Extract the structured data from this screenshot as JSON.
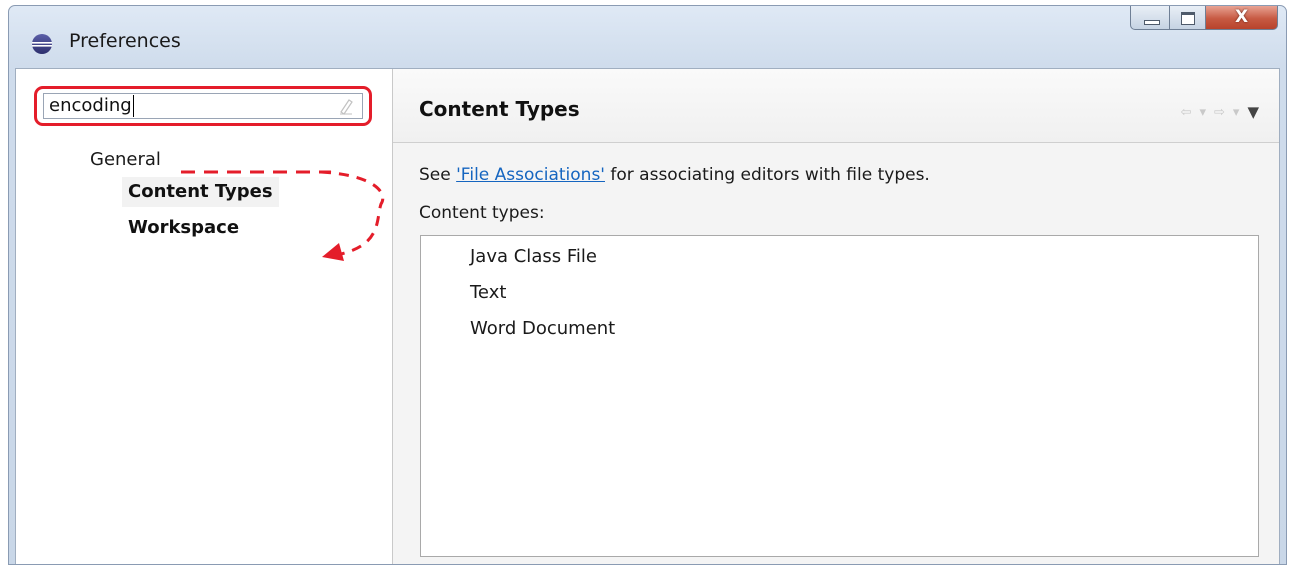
{
  "window": {
    "title": "Preferences",
    "close_symbol": "X"
  },
  "filter": {
    "value": "encoding",
    "clear_icon": "clear-filter-icon"
  },
  "tree": {
    "category": "General",
    "items": [
      {
        "label": "Content Types",
        "selected": true
      },
      {
        "label": "Workspace",
        "selected": false
      }
    ]
  },
  "page": {
    "title": "Content Types",
    "description_prefix": "See ",
    "description_link": "'File Associations'",
    "description_suffix": " for associating editors with file types.",
    "list_label": "Content types:",
    "content_types": [
      "Java Class File",
      "Text",
      "Word Document"
    ]
  },
  "colors": {
    "highlight": "#e41d2a",
    "link": "#1565c0"
  }
}
